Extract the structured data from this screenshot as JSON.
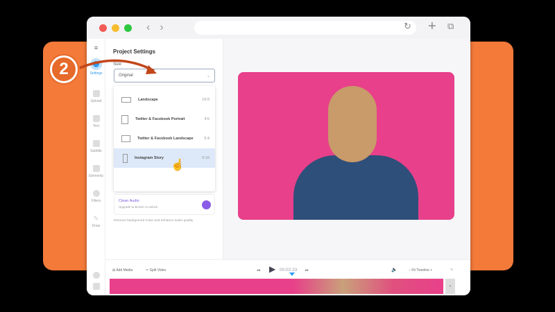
{
  "step_badge": "2",
  "sidebar": {
    "items": [
      {
        "label": "Settings"
      },
      {
        "label": "Upload"
      },
      {
        "label": "Text"
      },
      {
        "label": "Subtitle"
      },
      {
        "label": "Elements"
      },
      {
        "label": "Filters"
      },
      {
        "label": "Draw"
      }
    ]
  },
  "panel": {
    "title": "Project Settings",
    "size_label": "Size",
    "size_value": "Original",
    "options": [
      {
        "label": "Landscape",
        "ratio": "16:9"
      },
      {
        "label": "Twitter & Facebook Portrait",
        "ratio": "4:5"
      },
      {
        "label": "Twitter & Facebook Landscape",
        "ratio": "5:4"
      },
      {
        "label": "Instagram Story",
        "ratio": "9:16"
      }
    ],
    "clean_audio": {
      "title": "Clean Audio",
      "subtitle": "Upgrade to BASIC to unlock",
      "description": "Remove background noise and enhance audio quality"
    }
  },
  "timeline": {
    "add_media": "Add Media",
    "split_video": "Split Video",
    "time": "00:02:23",
    "fit": "Fit Timeline"
  },
  "colors": {
    "accent": "#2f9bf0",
    "orange": "#f47a3a",
    "photo_bg": "#e8408a",
    "selected": "#dde8f8"
  }
}
